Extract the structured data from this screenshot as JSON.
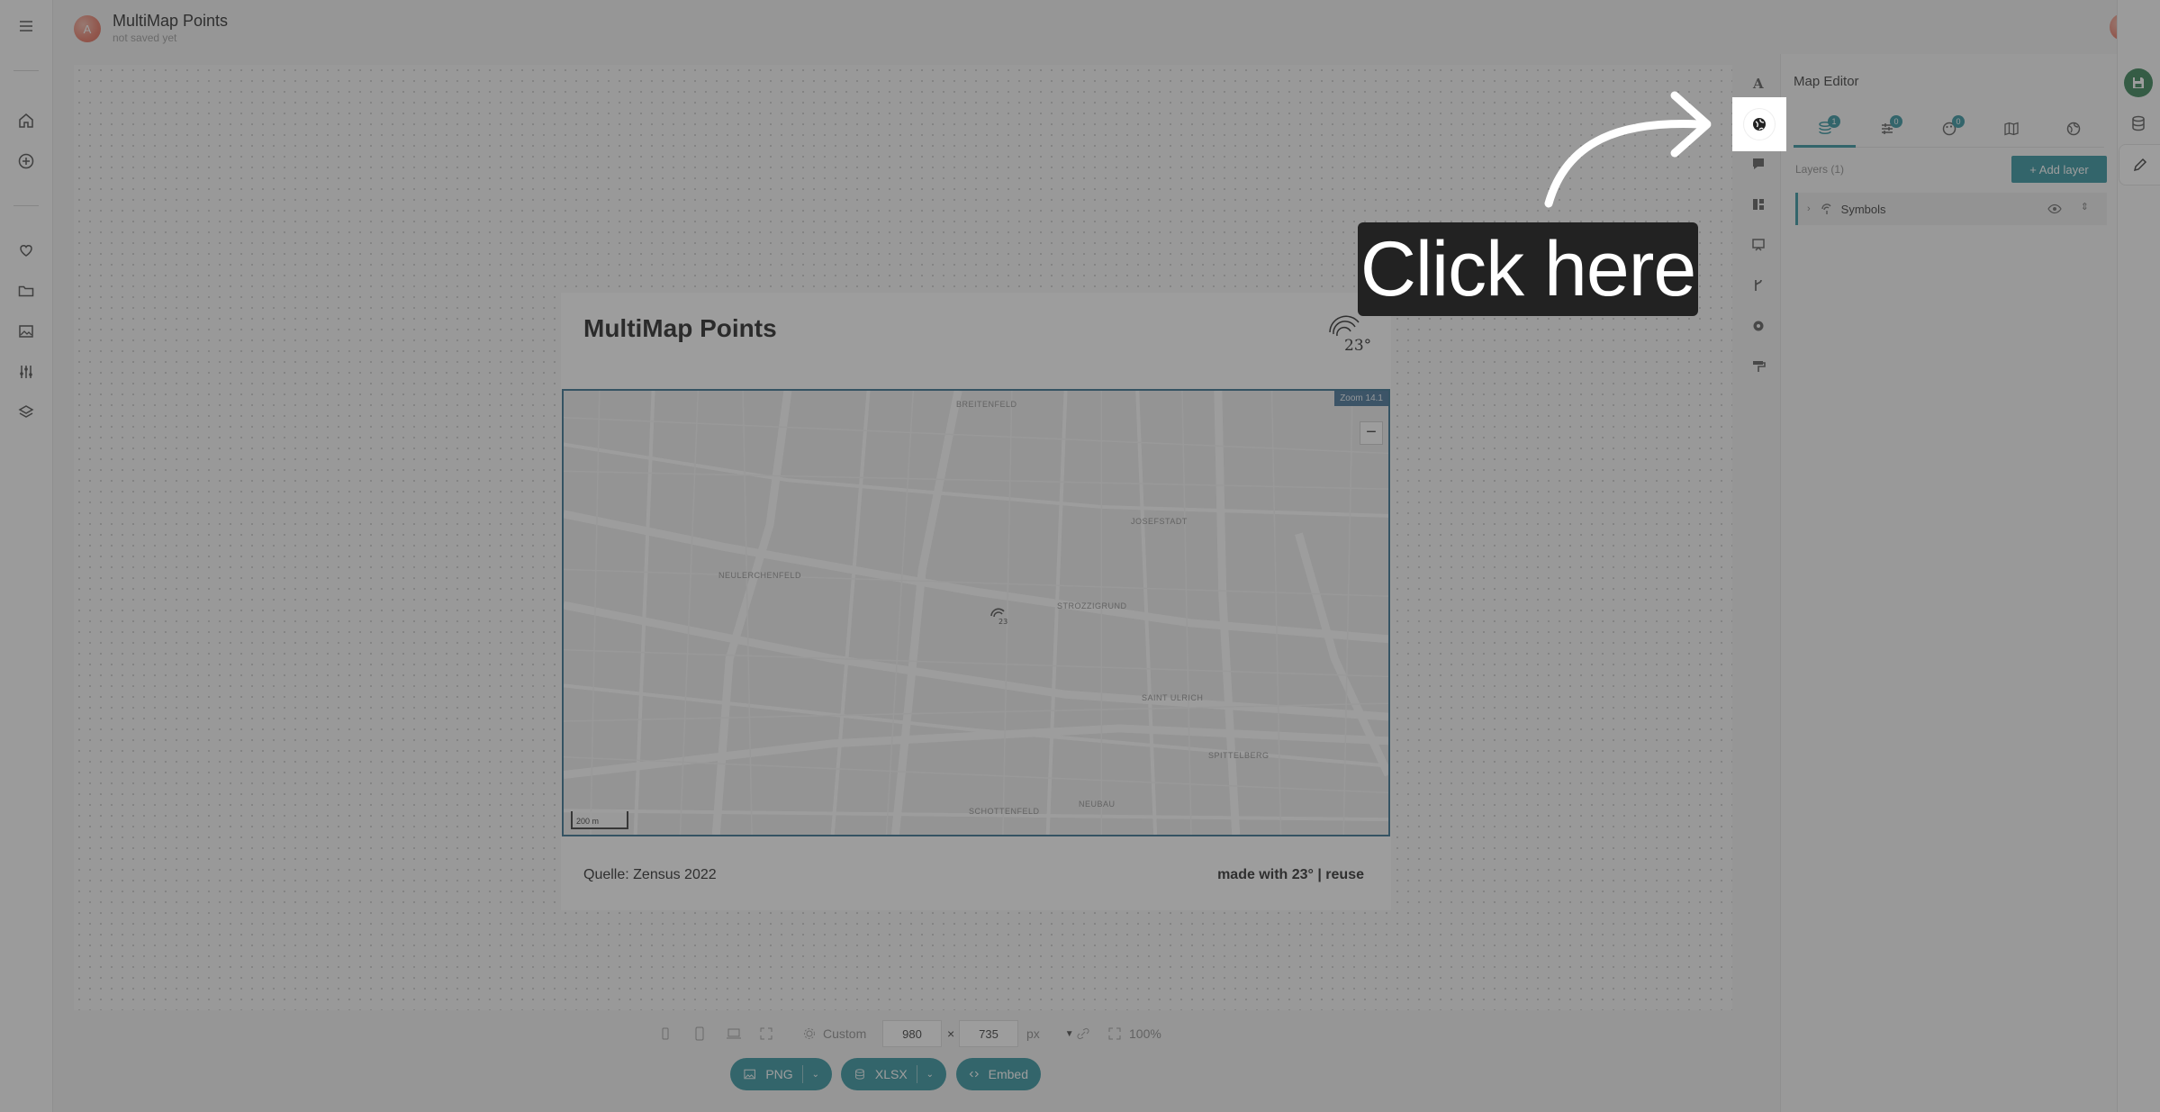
{
  "header": {
    "user_initial": "A",
    "project_title": "MultiMap Points",
    "project_status": "not saved yet"
  },
  "left_rail": {
    "icons": [
      "menu-icon",
      "home-icon",
      "plus-circle-icon",
      "heart-icon",
      "folder-icon",
      "image-icon",
      "sliders-icon",
      "layers-icon"
    ]
  },
  "card": {
    "title": "MultiMap Points",
    "source": "Quelle: Zensus 2022",
    "credit": "made with 23° | reuse",
    "logo_text": "23°"
  },
  "map": {
    "zoom_badge": "Zoom 14.1",
    "zoom_minus": "−",
    "scale_label": "200 m",
    "district_labels": [
      {
        "name": "BREITENFELD"
      },
      {
        "name": "JOSEFSTADT"
      },
      {
        "name": "NEULERCHENFELD"
      },
      {
        "name": "STROZZIGRUND"
      },
      {
        "name": "SAINT ULRICH"
      },
      {
        "name": "SPITTELBERG"
      },
      {
        "name": "SCHOTTENFELD"
      },
      {
        "name": "NEUBAU"
      }
    ]
  },
  "size_bar": {
    "preset_label": "Custom",
    "width": "980",
    "times": "×",
    "height": "735",
    "unit": "px",
    "zoom": "100%"
  },
  "export": {
    "png_label": "PNG",
    "xlsx_label": "XLSX",
    "embed_label": "Embed"
  },
  "panel": {
    "title": "Map Editor",
    "tabs": [
      {
        "icon": "layers-icon",
        "badge": "1"
      },
      {
        "icon": "filter-icon",
        "badge": "0"
      },
      {
        "icon": "palette-icon",
        "badge": "0"
      },
      {
        "icon": "map-icon",
        "badge": ""
      },
      {
        "icon": "globe-icon",
        "badge": ""
      }
    ],
    "layers_label": "Layers (1)",
    "add_layer_label": "+ Add layer",
    "layers": [
      {
        "name": "Symbols"
      }
    ]
  },
  "callout": {
    "text": "Click here"
  },
  "colors": {
    "accent": "#2a8f9a",
    "save": "#2e7d4f",
    "map_border": "#2e6b8a"
  }
}
